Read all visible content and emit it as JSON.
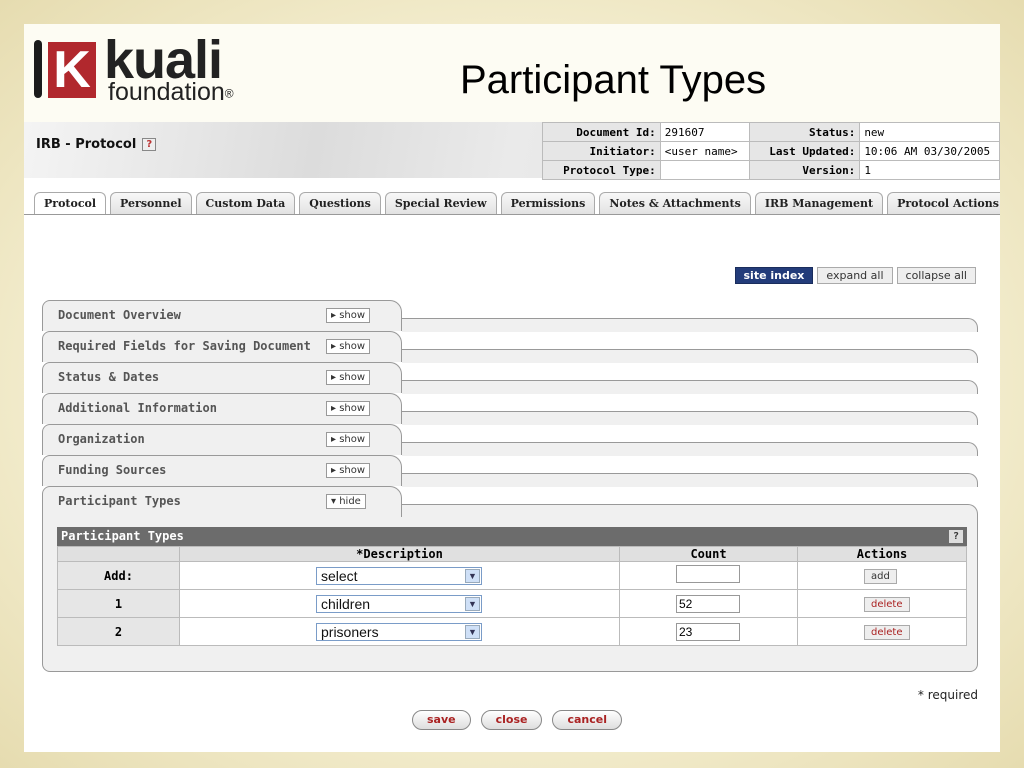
{
  "slide": {
    "logo_word": "kuali",
    "logo_sub": "foundation",
    "logo_reg": "®",
    "title": "Participant Types"
  },
  "app": {
    "title": "IRB - Protocol",
    "help_glyph": "?",
    "doc_info": {
      "document_id_label": "Document Id:",
      "document_id": "291607",
      "status_label": "Status:",
      "status": "new",
      "initiator_label": "Initiator:",
      "initiator": "<user name>",
      "last_updated_label": "Last Updated:",
      "last_updated": "10:06 AM 03/30/2005",
      "protocol_type_label": "Protocol Type:",
      "protocol_type": "",
      "version_label": "Version:",
      "version": "1"
    },
    "tabs": [
      "Protocol",
      "Personnel",
      "Custom Data",
      "Questions",
      "Special Review",
      "Permissions",
      "Notes & Attachments",
      "IRB Management",
      "Protocol Actions"
    ],
    "active_tab": "Protocol",
    "top_buttons": {
      "site_index": "site index",
      "expand_all": "expand all",
      "collapse_all": "collapse all"
    },
    "sections": [
      {
        "name": "Document Overview",
        "toggle": "▸ show"
      },
      {
        "name": "Required Fields for Saving Document",
        "toggle": "▸ show"
      },
      {
        "name": "Status & Dates",
        "toggle": "▸ show"
      },
      {
        "name": "Additional Information",
        "toggle": "▸ show"
      },
      {
        "name": "Organization",
        "toggle": "▸ show"
      },
      {
        "name": "Funding Sources",
        "toggle": "▸ show"
      },
      {
        "name": "Participant Types",
        "toggle": "▾ hide"
      }
    ],
    "participant_table": {
      "header": "Participant Types",
      "columns": [
        "",
        "*Description",
        "Count",
        "Actions"
      ],
      "add_row": {
        "label": "Add:",
        "description": "select",
        "count": "",
        "action": "add"
      },
      "rows": [
        {
          "num": "1",
          "description": "children",
          "count": "52",
          "action": "delete"
        },
        {
          "num": "2",
          "description": "prisoners",
          "count": "23",
          "action": "delete"
        }
      ]
    },
    "required_note": "* required",
    "bottom_buttons": {
      "save": "save",
      "close": "close",
      "cancel": "cancel"
    }
  },
  "colors": {
    "accent_red": "#b1282d",
    "site_index_blue": "#233c7a",
    "border": "#d8caa0"
  }
}
